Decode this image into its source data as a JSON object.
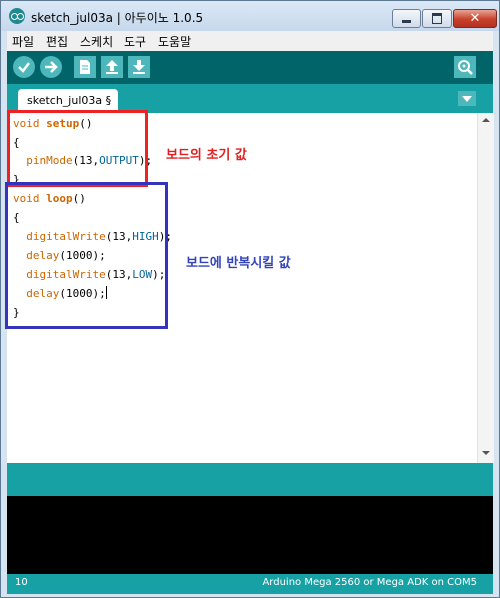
{
  "window": {
    "title": "sketch_jul03a | 아두이노 1.0.5"
  },
  "menu": [
    "파일",
    "편집",
    "스케치",
    "도구",
    "도움말"
  ],
  "toolbar": {
    "buttons": [
      "verify-icon",
      "upload-icon",
      "new-icon",
      "open-icon",
      "save-icon"
    ],
    "serial_monitor": "serial-monitor-icon"
  },
  "tab": {
    "label": "sketch_jul03a §"
  },
  "code": {
    "l1_type": "void",
    "l1_name": "setup",
    "l1_tail": "()",
    "l2": "{",
    "l3_fn": "pinMode",
    "l3_a": "(13,",
    "l3_const": "OUTPUT",
    "l3_b": ");",
    "l4": "}",
    "l5_type": "void",
    "l5_name": "loop",
    "l5_tail": "()",
    "l6": "{",
    "l7_fn": "digitalWrite",
    "l7_a": "(13,",
    "l7_const": "HIGH",
    "l7_b": ");",
    "l8_fn": "delay",
    "l8_a": "(1000);",
    "l9_fn": "digitalWrite",
    "l9_a": "(13,",
    "l9_const": "LOW",
    "l9_b": ");",
    "l10_fn": "delay",
    "l10_a": "(1000);",
    "l11": "}"
  },
  "annotations": {
    "setup_note": "보드의 초기 값",
    "loop_note": "보드에 반복시킬 값"
  },
  "status": {
    "line": "10",
    "board": "Arduino Mega 2560 or Mega ADK on COM5"
  },
  "colors": {
    "toolbar": "#006468",
    "tabstrip": "#17a1a5",
    "button": "#4db7bb",
    "keyword": "#cc6600",
    "constant": "#006699",
    "annotation_red": "#e02020",
    "annotation_blue": "#3344bb"
  }
}
